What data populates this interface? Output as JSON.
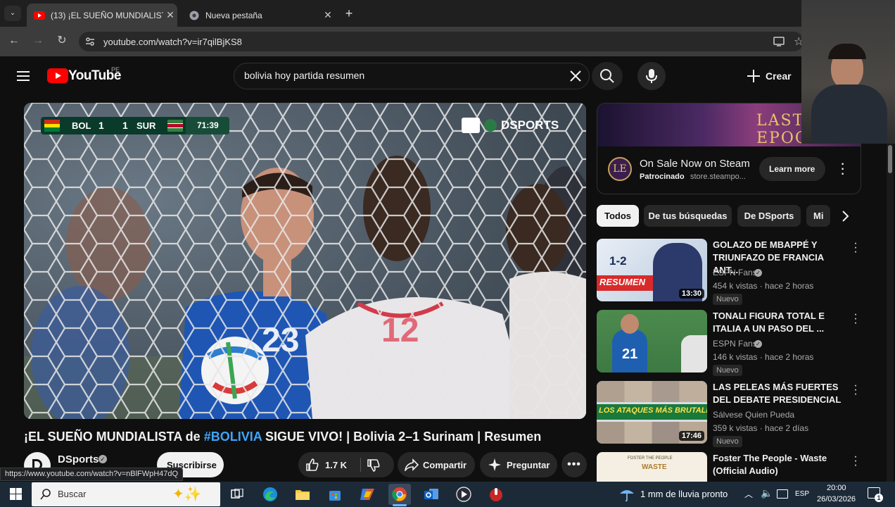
{
  "browser": {
    "tabs": [
      {
        "title": "(13) ¡EL SUEÑO MUNDIALISTA d",
        "active": true,
        "favicon": "youtube-icon"
      },
      {
        "title": "Nueva pestaña",
        "active": false,
        "favicon": "chrome-icon"
      }
    ],
    "url": "youtube.com/watch?v=ir7qilBjKS8",
    "status_url": "https://www.youtube.com/watch?v=nBlFWpH47dQ"
  },
  "header": {
    "logo_text": "YouTube",
    "country": "PE",
    "search_value": "bolivia hoy partida resumen",
    "create_label": "Crear"
  },
  "player": {
    "score": {
      "home": "BOL",
      "home_goals": "1",
      "away_goals": "1",
      "away": "SUR",
      "clock": "71:39"
    },
    "broadcaster": "DSPORTS",
    "jersey_left": "23",
    "jersey_right": "12"
  },
  "video": {
    "title_pre": "¡EL SUEÑO MUNDIALISTA de ",
    "title_tag": "#BOLIVIA",
    "title_post": " SIGUE VIVO! | Bolivia 2–1 Surinam | Resumen",
    "channel": "DSports",
    "subscribe_label": "Suscribirse",
    "likes": "1.7 K",
    "share_label": "Compartir",
    "ask_label": "Preguntar"
  },
  "ad": {
    "banner_text": "LAST EPOCH",
    "logo_text": "LE",
    "title": "On Sale Now on Steam",
    "sponsored": "Patrocinado",
    "domain": "store.steampo...",
    "cta": "Learn more"
  },
  "chips": [
    "Todos",
    "De tus búsquedas",
    "De DSports",
    "Mi"
  ],
  "recommendations": [
    {
      "title": "GOLAZO DE MBAPPÉ Y TRIUNFAZO DE FRANCIA ANT...",
      "channel": "ESPN Fans",
      "meta": "454 k vistas · hace 2 horas",
      "badge": "Nuevo",
      "duration": "13:30",
      "thumb_text": "1-2",
      "thumb_sub": "RESUMEN"
    },
    {
      "title": "TONALI FIGURA TOTAL E ITALIA A UN PASO DEL ...",
      "channel": "ESPN Fans",
      "meta": "146 k vistas · hace 2 horas",
      "badge": "Nuevo",
      "duration": "",
      "thumb_text": "21",
      "thumb_sub": ""
    },
    {
      "title": "LAS PELEAS MÁS FUERTES DEL DEBATE PRESIDENCIAL",
      "channel": "Sálvese Quien Pueda",
      "meta": "359 k vistas · hace 2 días",
      "badge": "Nuevo",
      "duration": "17:46",
      "thumb_text": "LOS ATAQUES MÁS BRUTALES",
      "thumb_sub": ""
    },
    {
      "title": "Foster The People - Waste (Official Audio)",
      "channel": "",
      "meta": "",
      "badge": "",
      "duration": "",
      "thumb_text": "WASTE",
      "thumb_sub": "FOSTER THE PEOPLE"
    }
  ],
  "taskbar": {
    "search_placeholder": "Buscar",
    "weather": "1 mm de lluvia pronto",
    "lang": "ESP",
    "time": "20:00",
    "date": "26/03/2026",
    "notif_count": "1"
  },
  "colors": {
    "youtube_red": "#ff0000",
    "link_blue": "#3ea6ff",
    "bg": "#0f0f0f"
  }
}
